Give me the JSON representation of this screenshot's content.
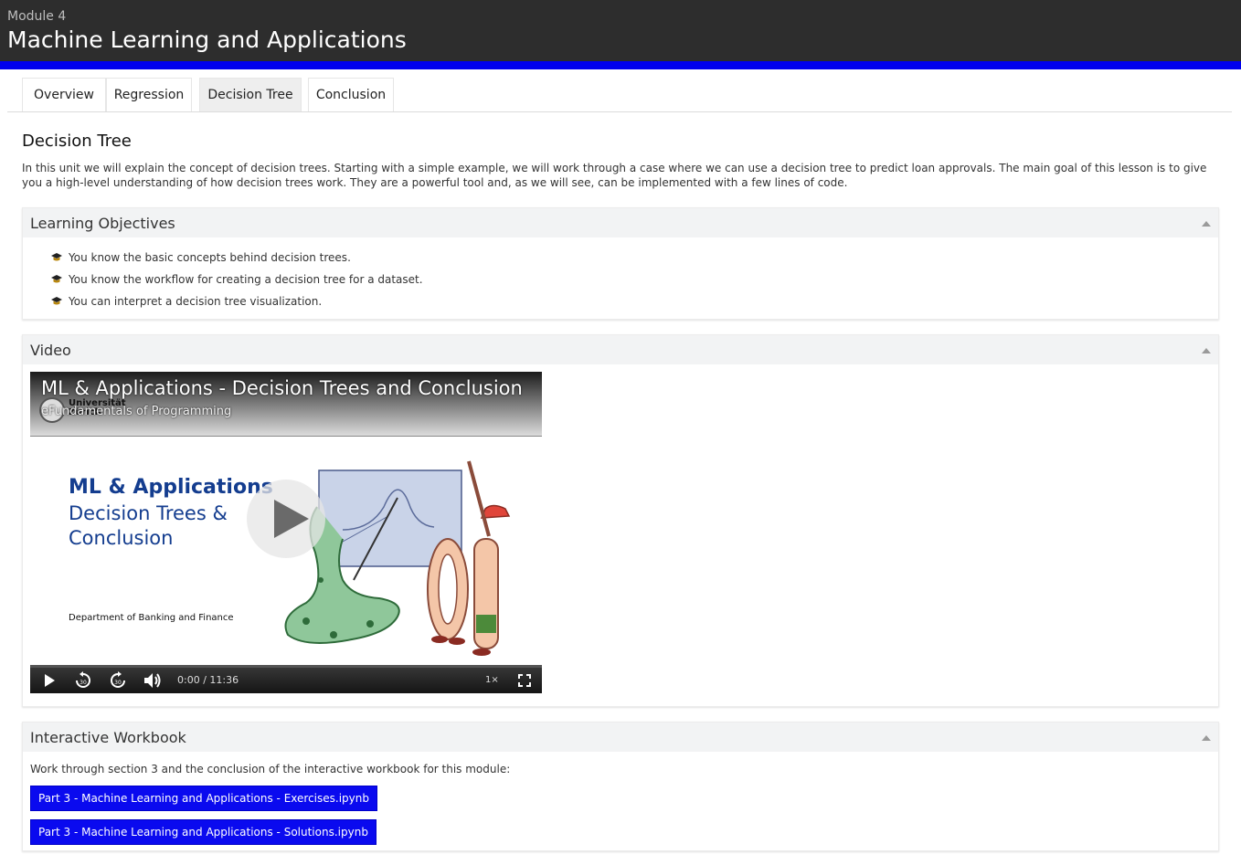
{
  "header": {
    "module_label": "Module 4",
    "title": "Machine Learning and Applications",
    "accent_color": "#0000ee"
  },
  "tabs": [
    {
      "label": "Overview",
      "active": false
    },
    {
      "label": "Regression",
      "active": false
    },
    {
      "label": "Decision Tree",
      "active": true
    },
    {
      "label": "Conclusion",
      "active": false
    }
  ],
  "unit": {
    "heading": "Decision Tree",
    "intro": "In this unit we will explain the concept of decision trees. Starting with a simple example, we will work through a case where we can use a decision tree to predict loan approvals. The main goal of this lesson is to give you a high-level understanding of how decision trees work. They are a powerful tool and, as we will see, can be implemented with a few lines of code."
  },
  "objectives": {
    "title": "Learning Objectives",
    "items": [
      "You know the basic concepts behind decision trees.",
      "You know the workflow for creating a decision tree for a dataset.",
      "You can interpret a decision tree visualization."
    ],
    "bullet_icon": "graduation-cap-icon"
  },
  "video": {
    "panel_title": "Video",
    "title": "ML & Applications - Decision Trees and Conclusion",
    "subtitle": "eFundamentals of Programming",
    "logo_text_line1": "Universität",
    "logo_text_line2": "Zürich",
    "slide_title": "ML & Applications",
    "slide_line2": "Decision Trees &",
    "slide_line3": "Conclusion",
    "slide_dept": "Department of Banking and Finance",
    "time": "0:00 / 11:36",
    "playback_rate": "1×",
    "progress": 0,
    "controls": [
      "play-icon",
      "rewind-30-icon",
      "forward-30-icon",
      "volume-icon",
      "fullscreen-icon"
    ]
  },
  "workbook": {
    "title": "Interactive Workbook",
    "text": "Work through section 3 and the conclusion of the interactive workbook for this module:",
    "links": [
      "Part 3 - Machine Learning and Applications - Exercises.ipynb",
      "Part 3 - Machine Learning and Applications - Solutions.ipynb"
    ],
    "link_color": "#0a0aef"
  }
}
